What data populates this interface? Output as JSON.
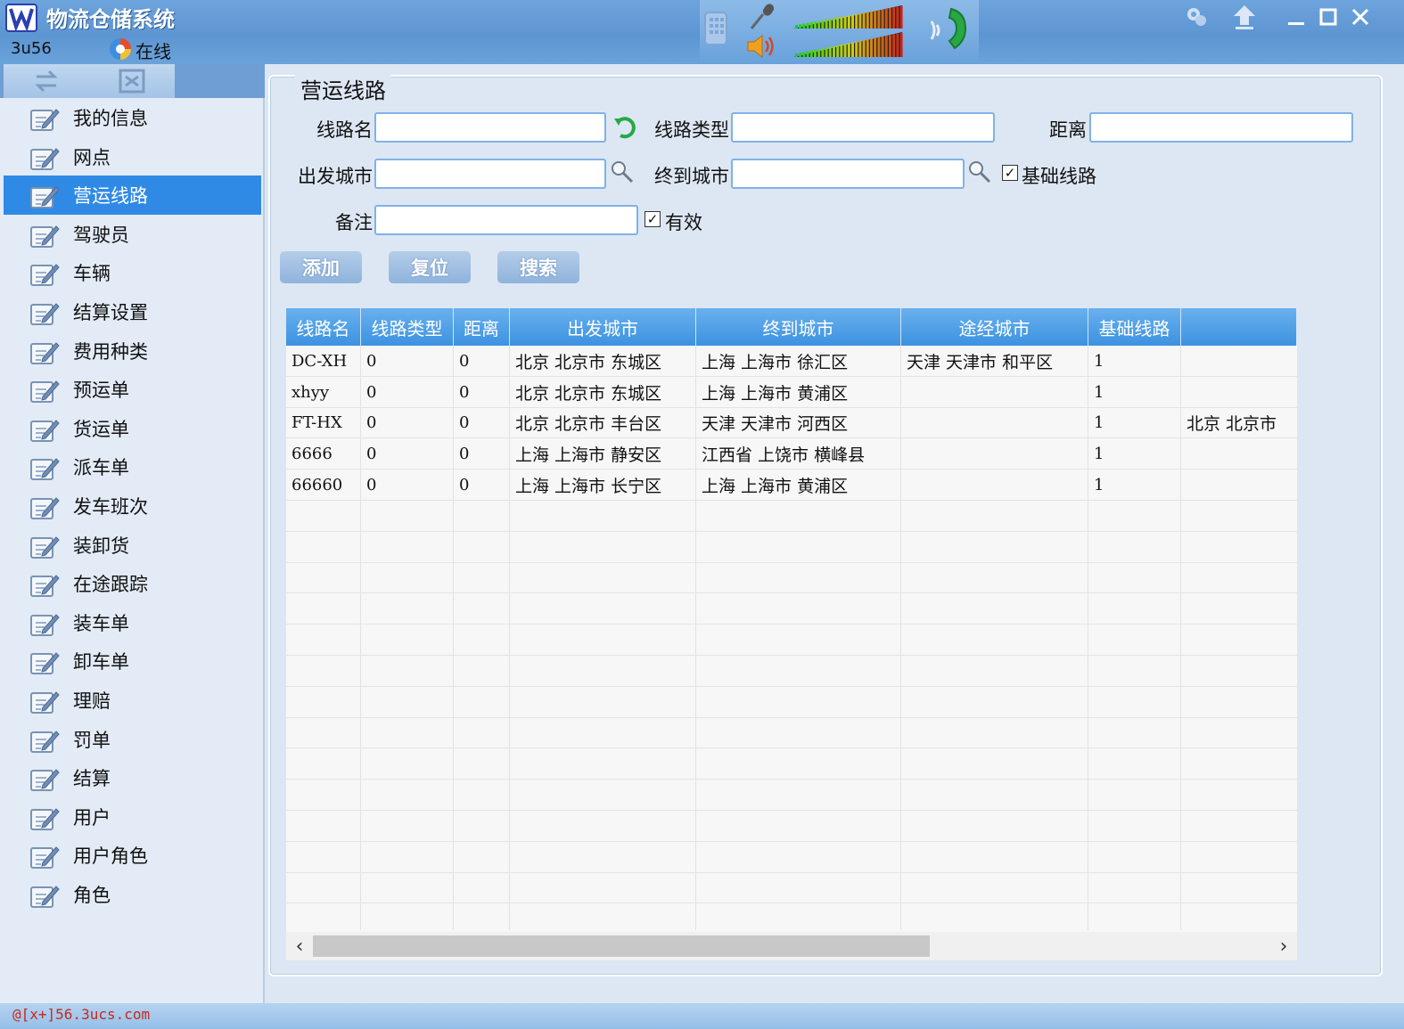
{
  "window": {
    "title": "物流仓储系统",
    "user_id": "3u56",
    "status": "在线",
    "controls": [
      "minimize",
      "maximize",
      "close"
    ]
  },
  "sidebar": {
    "items": [
      {
        "label": "我的信息",
        "selected": false
      },
      {
        "label": "网点",
        "selected": false
      },
      {
        "label": "营运线路",
        "selected": true
      },
      {
        "label": "驾驶员",
        "selected": false
      },
      {
        "label": "车辆",
        "selected": false
      },
      {
        "label": "结算设置",
        "selected": false
      },
      {
        "label": "费用种类",
        "selected": false
      },
      {
        "label": "预运单",
        "selected": false
      },
      {
        "label": "货运单",
        "selected": false
      },
      {
        "label": "派车单",
        "selected": false
      },
      {
        "label": "发车班次",
        "selected": false
      },
      {
        "label": "装卸货",
        "selected": false
      },
      {
        "label": "在途跟踪",
        "selected": false
      },
      {
        "label": "装车单",
        "selected": false
      },
      {
        "label": "卸车单",
        "selected": false
      },
      {
        "label": "理赔",
        "selected": false
      },
      {
        "label": "罚单",
        "selected": false
      },
      {
        "label": "结算",
        "selected": false
      },
      {
        "label": "用户",
        "selected": false
      },
      {
        "label": "用户角色",
        "selected": false
      },
      {
        "label": "角色",
        "selected": false
      }
    ]
  },
  "form": {
    "group_title": "营运线路",
    "route_name_label": "线路名",
    "route_name_value": "",
    "route_type_label": "线路类型",
    "route_type_value": "",
    "distance_label": "距离",
    "distance_value": "",
    "from_city_label": "出发城市",
    "from_city_value": "",
    "to_city_label": "终到城市",
    "to_city_value": "",
    "base_route_label": "基础线路",
    "base_route_checked": true,
    "remark_label": "备注",
    "remark_value": "",
    "valid_label": "有效",
    "valid_checked": true,
    "check_mark": "✓"
  },
  "buttons": {
    "add": "添加",
    "reset": "复位",
    "search": "搜索"
  },
  "table": {
    "columns": [
      "线路名",
      "线路类型",
      "距离",
      "出发城市",
      "终到城市",
      "途经城市",
      "基础线路",
      ""
    ],
    "rows": [
      [
        "DC-XH",
        "0",
        "0",
        "北京 北京市 东城区",
        "上海 上海市 徐汇区",
        "天津 天津市 和平区",
        "1",
        ""
      ],
      [
        "xhyy",
        "0",
        "0",
        "北京 北京市 东城区",
        "上海 上海市 黄浦区",
        "",
        "1",
        ""
      ],
      [
        "FT-HX",
        "0",
        "0",
        "北京 北京市 丰台区",
        "天津 天津市 河西区",
        "",
        "1",
        "北京 北京市"
      ],
      [
        "6666",
        "0",
        "0",
        "上海 上海市 静安区",
        "江西省 上饶市 横峰县",
        "",
        "1",
        ""
      ],
      [
        "66660",
        "0",
        "0",
        "上海 上海市 长宁区",
        "上海 上海市 黄浦区",
        "",
        "1",
        ""
      ]
    ],
    "scroll_left": "‹",
    "scroll_right": "›"
  },
  "statusbar": {
    "text": "@[x+]56.3ucs.com"
  },
  "colors": {
    "selected_item": "#2f8ae6",
    "header": "#3c92e0",
    "status_text": "#c8281e"
  }
}
